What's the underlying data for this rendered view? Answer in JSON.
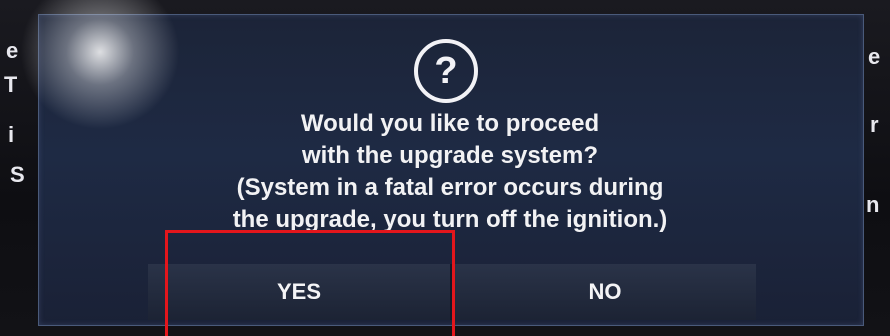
{
  "background": {
    "left_fragments": [
      "e",
      "T",
      "i",
      "S"
    ],
    "right_fragments": [
      "e",
      "r",
      "n"
    ]
  },
  "dialog": {
    "icon": "question-mark-icon",
    "icon_glyph": "?",
    "message_lines": [
      "Would you like to proceed",
      "with the upgrade system?",
      "(System in a fatal error occurs during",
      "the upgrade, you turn off the ignition.)"
    ],
    "buttons": {
      "yes_label": "YES",
      "no_label": "NO"
    }
  },
  "annotation": {
    "highlight_color": "#e3161c",
    "target": "yes-button"
  }
}
